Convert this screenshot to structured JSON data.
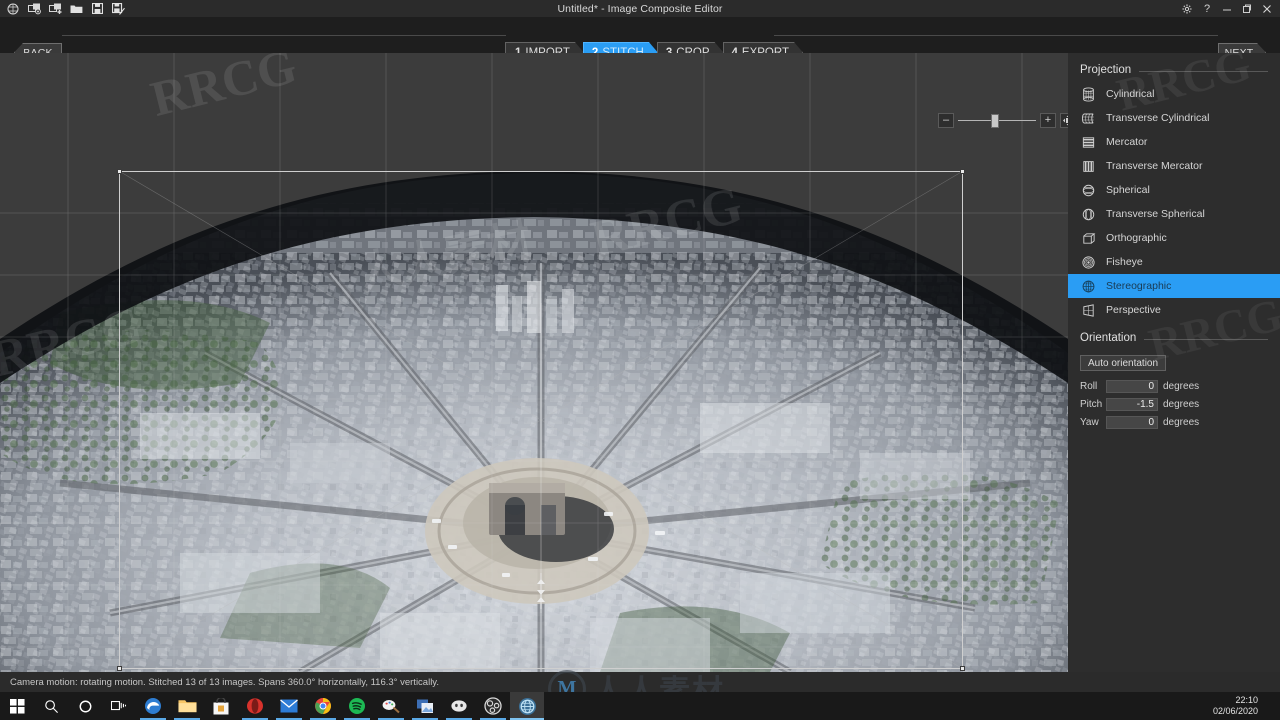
{
  "titlebar": {
    "title": "Untitled* - Image Composite Editor",
    "tools": [
      {
        "name": "new-panorama-icon",
        "label": "New panorama from video"
      },
      {
        "name": "new-from-images-icon",
        "label": "New panorama from images"
      },
      {
        "name": "add-images-icon",
        "label": "Add images"
      },
      {
        "name": "open-folder-icon",
        "label": "Open"
      },
      {
        "name": "save-icon",
        "label": "Save"
      },
      {
        "name": "save-as-icon",
        "label": "Save as"
      }
    ],
    "window_buttons": [
      {
        "name": "settings-icon",
        "glyph": "⚙"
      },
      {
        "name": "help-icon",
        "glyph": "?"
      },
      {
        "name": "minimize-icon",
        "glyph": "–"
      },
      {
        "name": "maximize-icon",
        "glyph": "❐"
      },
      {
        "name": "close-icon",
        "glyph": "✕"
      }
    ]
  },
  "nav": {
    "back_label": "BACK",
    "next_label": "NEXT",
    "steps": [
      {
        "num": "1",
        "label": "IMPORT",
        "active": false
      },
      {
        "num": "2",
        "label": "STITCH",
        "active": true
      },
      {
        "num": "3",
        "label": "CROP",
        "active": false
      },
      {
        "num": "4",
        "label": "EXPORT",
        "active": false
      }
    ]
  },
  "zoom_toolbar": {
    "zoom_out_label": "–",
    "zoom_in_label": "+",
    "fit_label": "fit-to-window",
    "slider_value": 42
  },
  "panel": {
    "projection": {
      "title": "Projection",
      "selected": "Stereographic",
      "items": [
        {
          "label": "Cylindrical",
          "icon": "cylindrical-icon"
        },
        {
          "label": "Transverse Cylindrical",
          "icon": "transverse-cylindrical-icon"
        },
        {
          "label": "Mercator",
          "icon": "mercator-icon"
        },
        {
          "label": "Transverse Mercator",
          "icon": "transverse-mercator-icon"
        },
        {
          "label": "Spherical",
          "icon": "spherical-icon"
        },
        {
          "label": "Transverse Spherical",
          "icon": "transverse-spherical-icon"
        },
        {
          "label": "Orthographic",
          "icon": "orthographic-icon"
        },
        {
          "label": "Fisheye",
          "icon": "fisheye-icon"
        },
        {
          "label": "Stereographic",
          "icon": "stereographic-icon"
        },
        {
          "label": "Perspective",
          "icon": "perspective-icon"
        }
      ]
    },
    "orientation": {
      "title": "Orientation",
      "auto_button": "Auto orientation",
      "fields": [
        {
          "label": "Roll",
          "value": "0",
          "unit": "degrees"
        },
        {
          "label": "Pitch",
          "value": "-1.5",
          "unit": "degrees"
        },
        {
          "label": "Yaw",
          "value": "0",
          "unit": "degrees"
        }
      ]
    }
  },
  "status": {
    "text": "Camera motion: rotating motion. Stitched 13 of 13 images. Spans 360.0° horizontally, 116.3° vertically."
  },
  "taskbar": {
    "items": [
      {
        "name": "start-button",
        "label": "Start"
      },
      {
        "name": "search-icon",
        "label": "Search"
      },
      {
        "name": "cortana-icon",
        "label": "Cortana"
      },
      {
        "name": "task-view-icon",
        "label": "Task View"
      },
      {
        "name": "edge-icon",
        "label": "Microsoft Edge"
      },
      {
        "name": "file-explorer-icon",
        "label": "File Explorer"
      },
      {
        "name": "microsoft-store-icon",
        "label": "Microsoft Store"
      },
      {
        "name": "opera-icon",
        "label": "Opera"
      },
      {
        "name": "mail-icon",
        "label": "Mail"
      },
      {
        "name": "chrome-icon",
        "label": "Google Chrome"
      },
      {
        "name": "spotify-icon",
        "label": "Spotify"
      },
      {
        "name": "paint3d-icon",
        "label": "Paint 3D"
      },
      {
        "name": "photos-icon",
        "label": "Photos"
      },
      {
        "name": "discord-icon",
        "label": "Discord"
      },
      {
        "name": "obs-icon",
        "label": "OBS Studio"
      },
      {
        "name": "ice-icon",
        "label": "Image Composite Editor"
      }
    ],
    "clock": {
      "time": "22:10",
      "date": "02/06/2020"
    }
  },
  "watermarks": {
    "text": "RRCG",
    "logo_letter": "M",
    "logo_cn": "人人素材"
  },
  "colors": {
    "accent": "#2a9df4",
    "panel_bg": "#2d2d2d",
    "canvas_bg": "#383838",
    "titlebar_bg": "#2b2b2b"
  }
}
